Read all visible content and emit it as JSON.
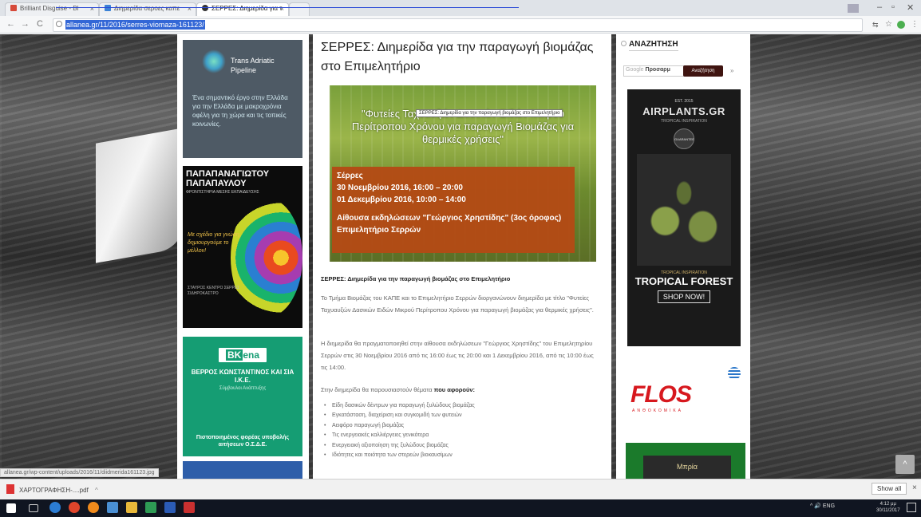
{
  "browser": {
    "tabs": [
      {
        "label": "Brilliant Disguise - Bl",
        "color": "#d64a3a"
      },
      {
        "label": "Διημερίδα σεροες καπε",
        "color": "#3b82d6"
      },
      {
        "label": "ΣΕΡΡΕΣ: Διημερίδα για τ",
        "color": "#333333"
      }
    ],
    "close_glyph": "×",
    "url": "allanea.gr/11/2016/serres-viomaza-161123/",
    "status_url": "allanea.gr/wp-content/uploads/2016/11/diidmerida161123.jpg"
  },
  "ads": {
    "tap": {
      "name": "Trans Adriatic Pipeline",
      "text": "Ένα σημαντικό έργο στην Ελλάδα για την Ελλάδα με μακροχρόνια οφέλη για τη χώρα και τις τοπικές κοινωνίες."
    },
    "papapanagiotou": {
      "title": "ΠΑΠΑΠΑΝΑΓΙΩΤΟΥ ΠΑΠΑΠΑΥΛΟΥ",
      "subtitle": "ΦΡΟΝΤΙΣΤΗΡΙΑ ΜΕΣΗΣ ΕΚΠΑΙΔΕΥΣΗΣ",
      "slogan": "Με σχέδιο για γνώση, δημιουργούμε το μέλλον!",
      "contacts": "ΣΤΑΥΡΟΣ ΚΕΝΤΡΟ ΣΕΡΡΕΣ ΣΙΔΗΡΟΚΑΣΤΡΟ"
    },
    "bk": {
      "logo_a": "BK",
      "logo_b": "ena",
      "name": "ΒΕΡΡΟΣ ΚΩΝΣΤΑΝΤΙΝΟΣ ΚΑΙ ΣΙΑ Ι.Κ.Ε.",
      "sub": "Σύμβουλοι Ανάπτυξης",
      "foot": "Πιστοποιημένος φορέας υποβολής αιτήσεων Ο.Σ.Δ.Ε."
    },
    "airplants": {
      "est": "EST. 2015",
      "name": "AIRPLANTS.GR",
      "tagline": "TROPICAL INSPIRATION",
      "badge": "GUARANTEE",
      "origin": "TROPICAL INSPIRATION",
      "forest": "TROPICAL FOREST",
      "shop": "SHOP NOW!"
    },
    "flos": {
      "logo": "FLOS",
      "sub": "ΑΝΘΟΚΟΜΙΚΑ"
    },
    "mpriya": {
      "label": "Μπρία"
    }
  },
  "article": {
    "title": "ΣΕΡΡΕΣ: Διημερίδα για την παραγωγή βιομάζας στο Επιμελητήριο",
    "hero_line": "\"Φυτείες Ταχυαυξών Δασικών Ειδών Μικρού Περίτροπου Χρόνου για παραγωγή Βιομάζας για θερμικές χρήσεις\"",
    "hero_tooltip": "ΣΕΡΡΕΣ: Διημερίδα για την παραγωγή βιομάζας στο Επιμελητήριο",
    "hero_place": "Σέρρες",
    "hero_date1": "30 Νοεμβρίου 2016, 16:00 – 20:00",
    "hero_date2": "01 Δεκεμβρίου 2016, 10:00 – 14:00",
    "hero_venue1": "Αίθουσα εκδηλώσεων \"Γεώργιος Χρηστίδης\" (3ος όροφος)",
    "hero_venue2": "Επιμελητήριο Σερρών",
    "body_heading": "ΣΕΡΡΕΣ: Διημερίδα για την παραγωγή βιομάζας στο Επιμελητήριο",
    "p1": "Το Τμήμα Βιομάζας του ΚΑΠΕ και το Επιμελητήριο Σερρών διοργανώνουν διημερίδα με τίτλο \"Φυτείες Ταχυαυξών Δασικών Ειδών Μικρού Περίτροπου Χρόνου για παραγωγή βιομάζας για θερμικές χρήσεις\".",
    "p2": "Η διημερίδα θα πραγματοποιηθεί στην αίθουσα εκδηλώσεων \"Γεώργιος Χρηστίδης\" του Επιμελητηρίου Σερρών στις 30 Νοεμβρίου 2016 από τις 16:00 έως τις 20:00 και 1 Δεκεμβρίου 2016, από τις 10:00 έως τις 14:00.",
    "p3": "Στην διημερίδα θα παρουσιαστούν θέματα",
    "p3_bold": "που αφορούν:",
    "list": [
      "Είδη δασικών δέντρων για παραγωγή ξυλώδους βιομάζας",
      "Εγκατάσταση, διαχείριση και συγκομιδή των φυτειών",
      "Αειφόρο παραγωγή βιομάζας",
      "Τις ενεργειακές καλλιέργειες γενικότερα",
      "Ενεργειακή αξιοποίηση της ξυλώδους βιομάζας",
      "Ιδιότητες και ποιότητα των στερεών βιοκαυσίμων"
    ]
  },
  "search": {
    "heading": "ΑΝΑΖΗΤΗΣΗ",
    "google": "Google",
    "placeholder": "Προσαρμ",
    "button": "Αναζήτηση",
    "more": "»"
  },
  "downloads": {
    "file": "ΧΑΡΤΟΓΡΑΦΗΣΗ-....pdf",
    "chevron": "^",
    "show_all": "Show all",
    "close": "×"
  },
  "taskbar": {
    "tray": "^ 🔊 ENG",
    "lang": "EN",
    "time": "4:12 μμ",
    "date": "30/11/2017"
  }
}
